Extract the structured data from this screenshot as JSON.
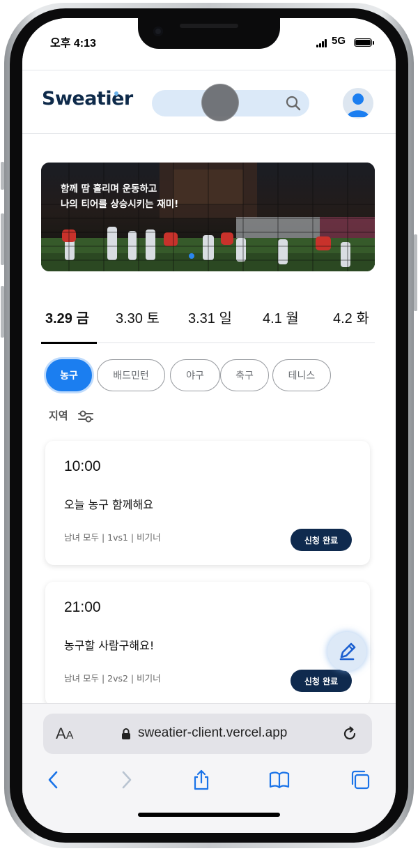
{
  "status_bar": {
    "time": "오후 4:13",
    "network": "5G"
  },
  "header": {
    "logo_text": "Sweatier",
    "search_placeholder": "",
    "brand_color": "#0e2a4a",
    "accent_color": "#1b7ef0"
  },
  "banner": {
    "line1": "함께 땀 흘리며 운동하고",
    "line2": "나의 티어를 상승시키는 재미!"
  },
  "date_tabs": [
    {
      "label": "3.29 금",
      "active": true
    },
    {
      "label": "3.30 토",
      "active": false
    },
    {
      "label": "3.31 일",
      "active": false
    },
    {
      "label": "4.1 월",
      "active": false
    },
    {
      "label": "4.2 화",
      "active": false
    }
  ],
  "sport_chips": [
    {
      "label": "농구",
      "active": true
    },
    {
      "label": "배드민턴",
      "active": false
    },
    {
      "label": "야구",
      "active": false
    },
    {
      "label": "축구",
      "active": false
    },
    {
      "label": "테니스",
      "active": false
    }
  ],
  "filter": {
    "region_label": "지역",
    "icon": "filter-sliders-icon"
  },
  "matches": [
    {
      "time": "10:00",
      "title": "오늘 농구 함께해요",
      "meta": "남녀 모두 | 1vs1 | 비기너",
      "status": "신청 완료"
    },
    {
      "time": "21:00",
      "title": "농구할 사람구해요!",
      "meta": "남녀 모두 | 2vs2 | 비기너",
      "status": "신청 완료"
    }
  ],
  "fab": {
    "icon": "pen-icon"
  },
  "browser": {
    "aa_label_big": "A",
    "aa_label_small": "A",
    "url": "sweatier-client.vercel.app",
    "icons": [
      "back-icon",
      "forward-icon",
      "share-icon",
      "bookmarks-icon",
      "tabs-icon"
    ]
  }
}
